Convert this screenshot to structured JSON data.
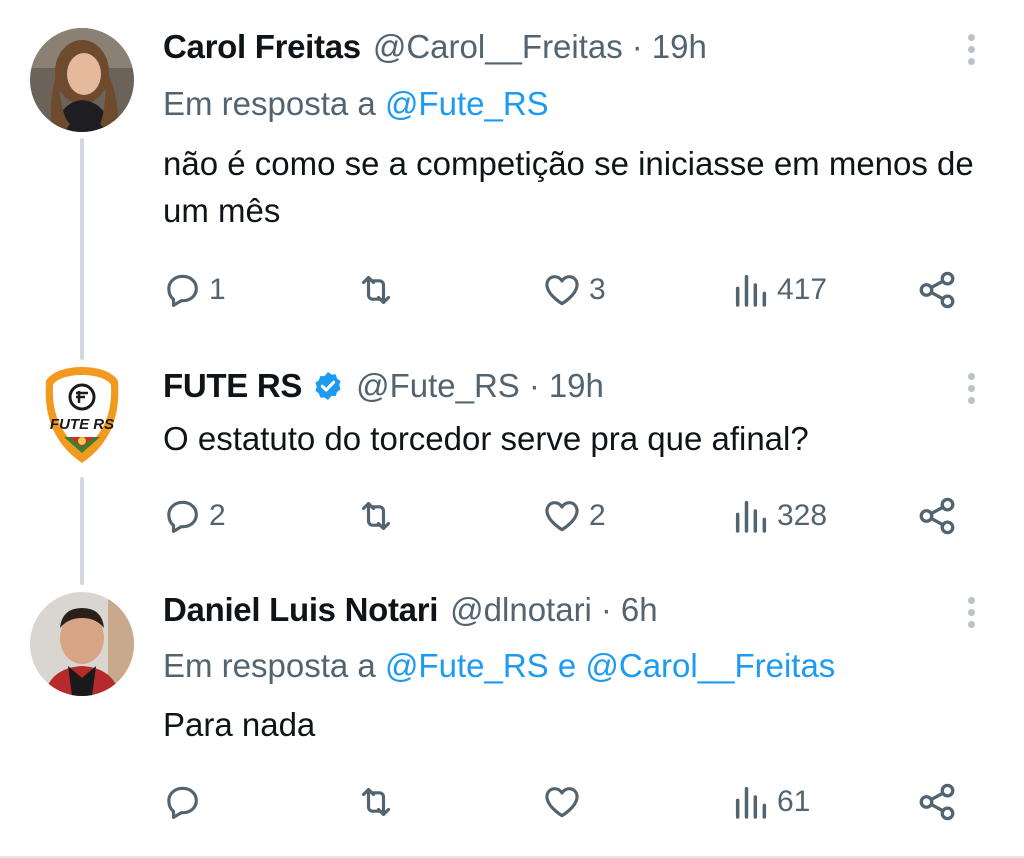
{
  "tweets": [
    {
      "name": "Carol Freitas",
      "handle": "@Carol__Freitas",
      "separator": "·",
      "time": "19h",
      "avatar_icon": "person-photo",
      "reply_prefix": "Em resposta a",
      "reply_mentions": [
        "@Fute_RS"
      ],
      "text": "não é como se a competição se iniciasse em menos de um mês",
      "replies": "1",
      "retweets": "",
      "likes": "3",
      "views": "417"
    },
    {
      "name": "FUTE RS",
      "handle": "@Fute_RS",
      "separator": "·",
      "time": "19h",
      "verified": true,
      "avatar_icon": "fute-rs-shield-logo",
      "logo_text": "FUTE RS",
      "text": "O estatuto do torcedor serve pra que afinal?",
      "replies": "2",
      "retweets": "",
      "likes": "2",
      "views": "328"
    },
    {
      "name": "Daniel Luis Notari",
      "handle": "@dlnotari",
      "separator": "·",
      "time": "6h",
      "avatar_icon": "person-photo",
      "reply_prefix": "Em resposta a",
      "reply_mentions": [
        "@Fute_RS",
        "@Carol__Freitas"
      ],
      "reply_joiner": "e",
      "text": "Para nada",
      "replies": "",
      "retweets": "",
      "likes": "",
      "views": "61"
    }
  ],
  "colors": {
    "text": "#0f1419",
    "secondary": "#536471",
    "link": "#1d9bf0",
    "thread_line": "#cfd9de",
    "verified_badge": "#1d9bf0"
  },
  "icons": {
    "reply": "speech-bubble-icon",
    "retweet": "retweet-arrows-icon",
    "like": "heart-icon",
    "views": "bar-chart-icon",
    "share": "share-nodes-icon",
    "more": "vertical-ellipsis-icon"
  }
}
